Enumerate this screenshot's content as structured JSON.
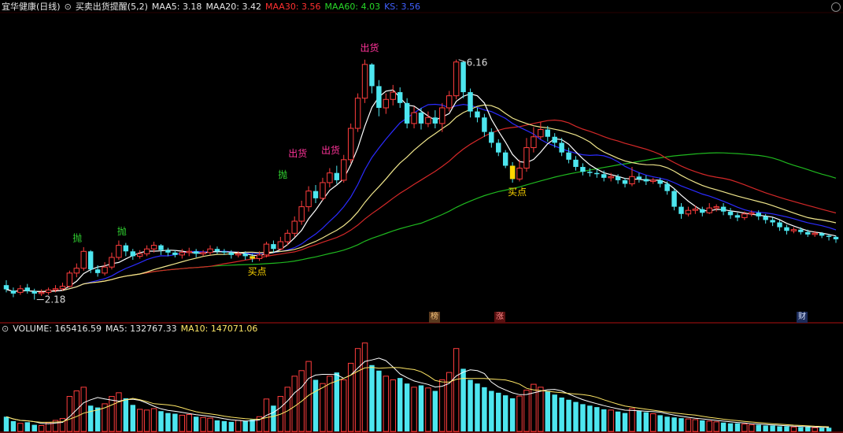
{
  "header": {
    "stock_name": "宜华健康(日线)",
    "indicator_name": "买卖出货提醒(5,2)",
    "ma5": "MAA5: 3.18",
    "ma20": "MAA20: 3.42",
    "ma30": "MAA30: 3.56",
    "ma60": "MAA60: 4.03",
    "ks": "KS: 3.56"
  },
  "volume_header": {
    "volume": "VOLUME: 165416.59",
    "ma5": "MA5: 132767.33",
    "ma10": "MA10: 147071.06"
  },
  "colors": {
    "up": "#ff3d3d",
    "down": "#4de6ef",
    "ma5": "#ffffff",
    "ma20": "#f0e68c",
    "ma30": "#d42828",
    "ma60": "#1fb81f",
    "ks": "#2b2bff",
    "frame": "#b01010",
    "buy": "#ffd700"
  },
  "tags": {
    "bang": "榜",
    "zhang": "涨",
    "cai": "财"
  },
  "annotations": {
    "low": "2.18",
    "high": "6.16",
    "sell": "出货",
    "dump": "抛",
    "buy": "买点"
  },
  "chart_data": {
    "type": "candlestick",
    "title": "宜华健康(日线)",
    "ylim": [
      1.9,
      6.6
    ],
    "low_label": "2.18",
    "high_label": "6.16",
    "candles": [
      [
        2.42,
        2.35,
        2.5,
        2.3
      ],
      [
        2.33,
        2.28,
        2.38,
        2.22
      ],
      [
        2.3,
        2.36,
        2.42,
        2.26
      ],
      [
        2.38,
        2.32,
        2.44,
        2.28
      ],
      [
        2.32,
        2.28,
        2.36,
        2.18
      ],
      [
        2.28,
        2.3,
        2.35,
        2.24
      ],
      [
        2.3,
        2.34,
        2.38,
        2.26
      ],
      [
        2.34,
        2.36,
        2.42,
        2.3
      ],
      [
        2.36,
        2.4,
        2.46,
        2.33
      ],
      [
        2.4,
        2.62,
        2.66,
        2.38
      ],
      [
        2.62,
        2.7,
        2.78,
        2.55
      ],
      [
        2.7,
        2.98,
        3.05,
        2.66
      ],
      [
        2.98,
        2.68,
        3.0,
        2.62
      ],
      [
        2.68,
        2.62,
        2.75,
        2.56
      ],
      [
        2.62,
        2.72,
        2.8,
        2.58
      ],
      [
        2.72,
        2.88,
        2.96,
        2.68
      ],
      [
        2.88,
        3.08,
        3.16,
        2.84
      ],
      [
        3.08,
        2.98,
        3.12,
        2.9
      ],
      [
        2.98,
        2.9,
        3.02,
        2.84
      ],
      [
        2.9,
        2.94,
        3.0,
        2.86
      ],
      [
        2.94,
        3.02,
        3.08,
        2.9
      ],
      [
        3.02,
        3.08,
        3.14,
        2.96
      ],
      [
        3.08,
        3.0,
        3.1,
        2.92
      ],
      [
        3.0,
        2.96,
        3.04,
        2.9
      ],
      [
        2.96,
        2.92,
        3.0,
        2.88
      ],
      [
        2.92,
        2.96,
        3.02,
        2.86
      ],
      [
        2.96,
        2.98,
        3.04,
        2.9
      ],
      [
        2.98,
        2.94,
        3.02,
        2.88
      ],
      [
        2.94,
        2.96,
        3.0,
        2.9
      ],
      [
        2.96,
        3.02,
        3.08,
        2.92
      ],
      [
        3.02,
        2.98,
        3.06,
        2.94
      ],
      [
        2.98,
        2.96,
        3.02,
        2.92
      ],
      [
        2.96,
        2.92,
        3.0,
        2.86
      ],
      [
        2.92,
        2.94,
        2.98,
        2.88
      ],
      [
        2.94,
        2.9,
        2.98,
        2.84
      ],
      [
        2.9,
        2.86,
        2.94,
        2.8
      ],
      [
        2.86,
        2.92,
        2.98,
        2.82
      ],
      [
        2.92,
        3.1,
        3.14,
        2.88
      ],
      [
        3.1,
        3.02,
        3.16,
        2.96
      ],
      [
        3.02,
        3.14,
        3.22,
        3.0
      ],
      [
        3.14,
        3.28,
        3.34,
        3.08
      ],
      [
        3.28,
        3.48,
        3.56,
        3.22
      ],
      [
        3.48,
        3.72,
        3.82,
        3.42
      ],
      [
        3.72,
        3.98,
        4.06,
        3.64
      ],
      [
        3.98,
        3.86,
        4.08,
        3.78
      ],
      [
        3.86,
        4.12,
        4.2,
        3.82
      ],
      [
        4.12,
        4.28,
        4.36,
        4.04
      ],
      [
        4.28,
        4.16,
        4.4,
        4.1
      ],
      [
        4.16,
        4.5,
        4.58,
        4.12
      ],
      [
        4.5,
        5.02,
        5.1,
        4.44
      ],
      [
        5.02,
        5.52,
        5.6,
        4.96
      ],
      [
        5.52,
        6.08,
        6.16,
        5.44
      ],
      [
        6.08,
        5.72,
        6.1,
        5.6
      ],
      [
        5.72,
        5.36,
        5.82,
        5.22
      ],
      [
        5.36,
        5.5,
        5.6,
        5.26
      ],
      [
        5.5,
        5.62,
        5.74,
        5.4
      ],
      [
        5.62,
        5.44,
        5.7,
        5.36
      ],
      [
        5.44,
        5.1,
        5.52,
        5.02
      ],
      [
        5.1,
        5.28,
        5.38,
        5.02
      ],
      [
        5.28,
        5.1,
        5.36,
        5.0
      ],
      [
        5.1,
        5.2,
        5.3,
        5.04
      ],
      [
        5.2,
        5.1,
        5.32,
        5.02
      ],
      [
        5.1,
        5.36,
        5.44,
        4.96
      ],
      [
        5.36,
        5.56,
        5.64,
        5.3
      ],
      [
        5.56,
        6.12,
        6.16,
        5.5
      ],
      [
        6.12,
        5.62,
        6.14,
        5.52
      ],
      [
        5.62,
        5.3,
        5.68,
        5.2
      ],
      [
        5.3,
        5.2,
        5.36,
        5.12
      ],
      [
        5.2,
        4.96,
        5.26,
        4.88
      ],
      [
        4.96,
        4.78,
        5.02,
        4.7
      ],
      [
        4.78,
        4.62,
        4.84,
        4.56
      ],
      [
        4.62,
        4.4,
        4.66,
        4.36
      ],
      [
        4.4,
        4.18,
        4.46,
        4.12
      ],
      [
        4.18,
        4.36,
        4.5,
        4.14
      ],
      [
        4.36,
        4.7,
        4.86,
        4.3
      ],
      [
        4.7,
        4.88,
        5.04,
        4.62
      ],
      [
        4.88,
        5.0,
        5.12,
        4.84
      ],
      [
        5.0,
        4.88,
        5.06,
        4.8
      ],
      [
        4.88,
        4.78,
        4.94,
        4.7
      ],
      [
        4.78,
        4.62,
        4.86,
        4.56
      ],
      [
        4.62,
        4.5,
        4.7,
        4.44
      ],
      [
        4.5,
        4.38,
        4.56,
        4.32
      ],
      [
        4.38,
        4.3,
        4.44,
        4.24
      ],
      [
        4.3,
        4.28,
        4.36,
        4.22
      ],
      [
        4.28,
        4.26,
        4.34,
        4.2
      ],
      [
        4.26,
        4.2,
        4.32,
        4.14
      ],
      [
        4.2,
        4.22,
        4.28,
        4.14
      ],
      [
        4.22,
        4.16,
        4.26,
        4.1
      ],
      [
        4.16,
        4.1,
        4.2,
        4.04
      ],
      [
        4.1,
        4.22,
        4.38,
        4.06
      ],
      [
        4.22,
        4.18,
        4.28,
        4.12
      ],
      [
        4.18,
        4.14,
        4.24,
        4.08
      ],
      [
        4.14,
        4.16,
        4.2,
        4.1
      ],
      [
        4.16,
        4.1,
        4.2,
        4.04
      ],
      [
        4.1,
        3.98,
        4.14,
        3.92
      ],
      [
        3.98,
        3.72,
        4.02,
        3.66
      ],
      [
        3.72,
        3.6,
        3.78,
        3.52
      ],
      [
        3.6,
        3.66,
        3.72,
        3.56
      ],
      [
        3.66,
        3.68,
        3.74,
        3.6
      ],
      [
        3.68,
        3.62,
        3.72,
        3.56
      ],
      [
        3.62,
        3.7,
        3.78,
        3.6
      ],
      [
        3.7,
        3.72,
        3.76,
        3.64
      ],
      [
        3.72,
        3.64,
        3.78,
        3.58
      ],
      [
        3.64,
        3.58,
        3.7,
        3.52
      ],
      [
        3.58,
        3.54,
        3.62,
        3.48
      ],
      [
        3.54,
        3.6,
        3.64,
        3.5
      ],
      [
        3.6,
        3.62,
        3.66,
        3.56
      ],
      [
        3.62,
        3.56,
        3.66,
        3.5
      ],
      [
        3.56,
        3.5,
        3.6,
        3.44
      ],
      [
        3.5,
        3.46,
        3.54,
        3.4
      ],
      [
        3.46,
        3.38,
        3.5,
        3.32
      ],
      [
        3.38,
        3.32,
        3.42,
        3.26
      ],
      [
        3.32,
        3.34,
        3.38,
        3.28
      ],
      [
        3.34,
        3.3,
        3.38,
        3.26
      ],
      [
        3.3,
        3.26,
        3.34,
        3.22
      ],
      [
        3.26,
        3.28,
        3.32,
        3.22
      ],
      [
        3.28,
        3.24,
        3.3,
        3.2
      ],
      [
        3.24,
        3.22,
        3.26,
        3.16
      ],
      [
        3.22,
        3.18,
        3.24,
        3.12
      ]
    ],
    "volumes": [
      40,
      28,
      22,
      25,
      18,
      16,
      24,
      30,
      35,
      95,
      110,
      120,
      70,
      65,
      75,
      95,
      105,
      90,
      72,
      60,
      58,
      62,
      55,
      50,
      48,
      44,
      46,
      40,
      38,
      36,
      30,
      28,
      26,
      30,
      28,
      32,
      40,
      88,
      70,
      95,
      120,
      150,
      165,
      190,
      140,
      130,
      150,
      160,
      140,
      185,
      225,
      240,
      180,
      165,
      150,
      140,
      145,
      130,
      120,
      125,
      118,
      110,
      140,
      160,
      225,
      170,
      140,
      130,
      120,
      110,
      105,
      98,
      90,
      96,
      112,
      128,
      120,
      110,
      100,
      92,
      86,
      80,
      74,
      70,
      66,
      60,
      58,
      54,
      50,
      62,
      56,
      52,
      48,
      44,
      40,
      38,
      36,
      34,
      32,
      30,
      28,
      26,
      24,
      22,
      22,
      20,
      18,
      18,
      16,
      16,
      14,
      14,
      12,
      12,
      12,
      10,
      10,
      10
    ]
  }
}
